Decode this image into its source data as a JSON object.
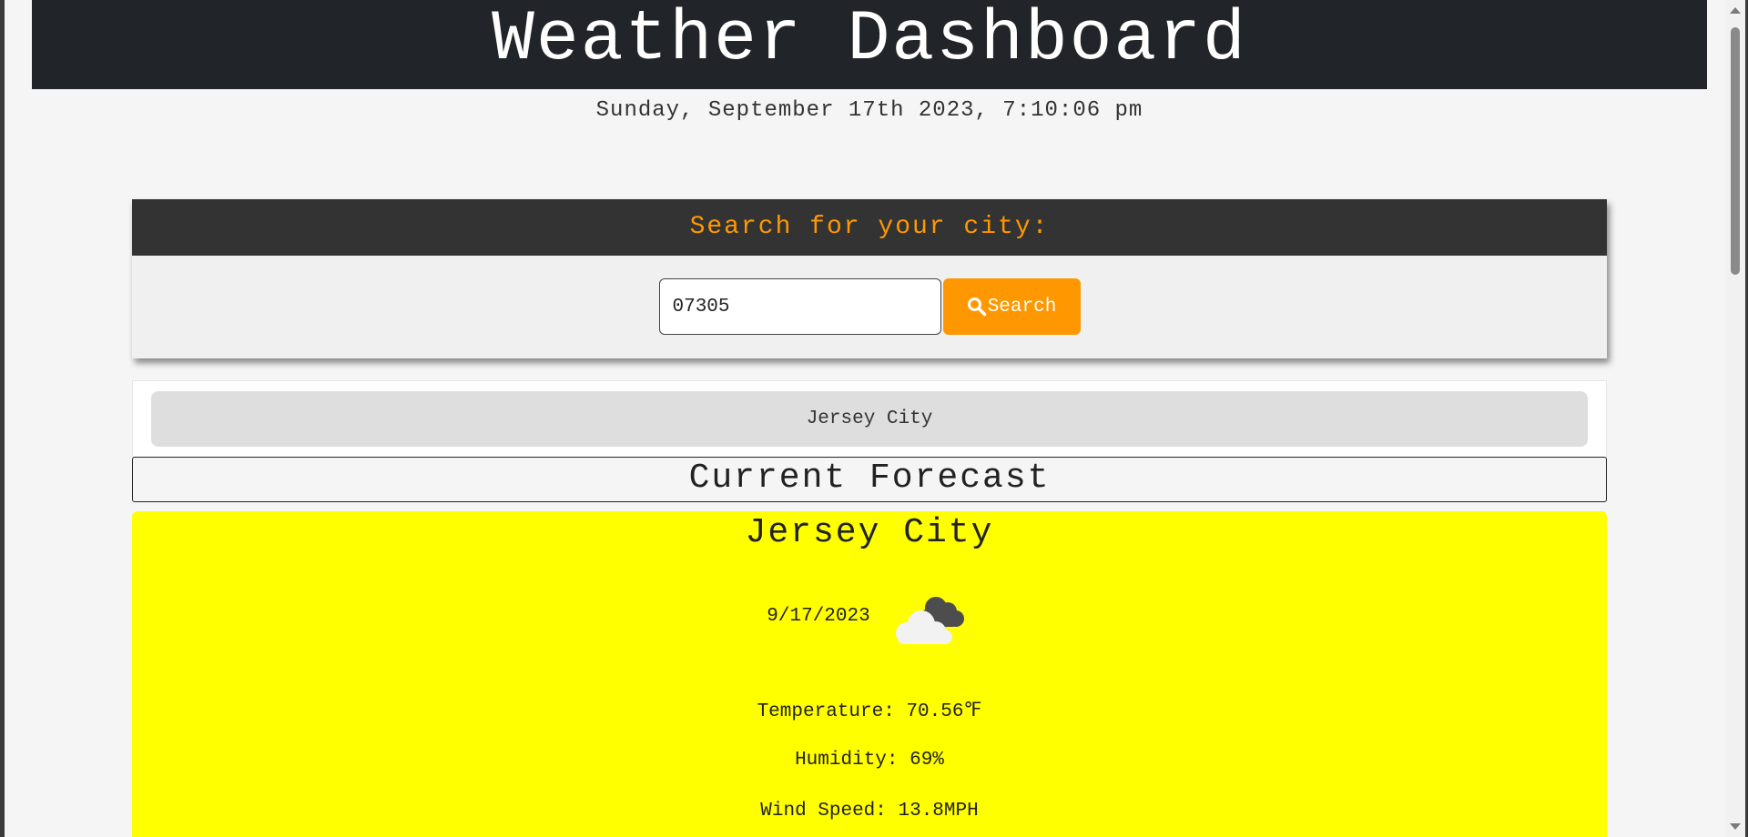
{
  "header": {
    "title": "Weather Dashboard",
    "datetime": "Sunday, September 17th 2023, 7:10:06 pm"
  },
  "search": {
    "heading": "Search for your city:",
    "input_value": "07305",
    "button_label": "Search",
    "button_icon": "search-icon",
    "accent_color": "#ff9800"
  },
  "history": {
    "items": [
      {
        "label": "Jersey City"
      }
    ]
  },
  "current": {
    "section_title": "Current Forecast",
    "city": "Jersey City",
    "date": "9/17/2023",
    "weather_icon": "cloudy-icon",
    "card_color": "#ffff00",
    "temperature_text": "Temperature: 70.56℉",
    "humidity_text": "Humidity: 69%",
    "wind_text": "Wind Speed: 13.8MPH"
  }
}
